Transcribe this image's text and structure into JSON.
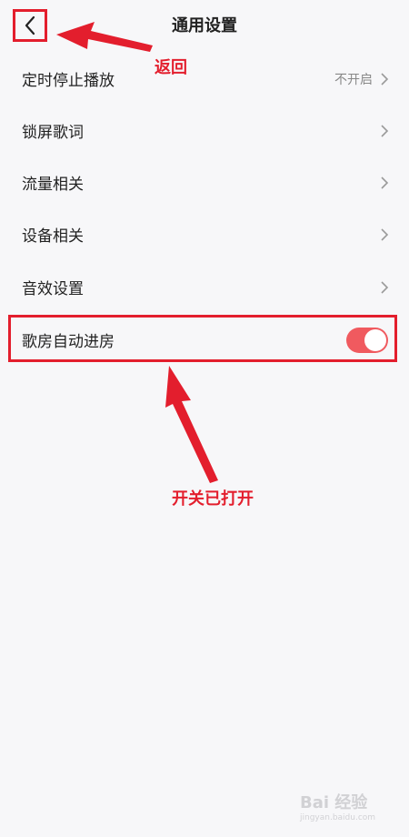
{
  "header": {
    "title": "通用设置",
    "back_icon": "chevron-left-icon"
  },
  "settings": [
    {
      "label": "定时停止播放",
      "value": "不开启",
      "type": "nav"
    },
    {
      "label": "锁屏歌词",
      "value": "",
      "type": "nav"
    },
    {
      "label": "流量相关",
      "value": "",
      "type": "nav"
    },
    {
      "label": "设备相关",
      "value": "",
      "type": "nav"
    },
    {
      "label": "音效设置",
      "value": "",
      "type": "nav"
    },
    {
      "label": "歌房自动进房",
      "type": "toggle",
      "state": "on"
    }
  ],
  "annotations": {
    "back_note": "返回",
    "switch_note": "开关已打开",
    "color": "#e31e2d"
  },
  "colors": {
    "toggle_on": "#f05a5f",
    "background": "#f7f7f9"
  },
  "watermark": {
    "text": "Bai 经验",
    "sub": "jingyan.baidu.com"
  }
}
